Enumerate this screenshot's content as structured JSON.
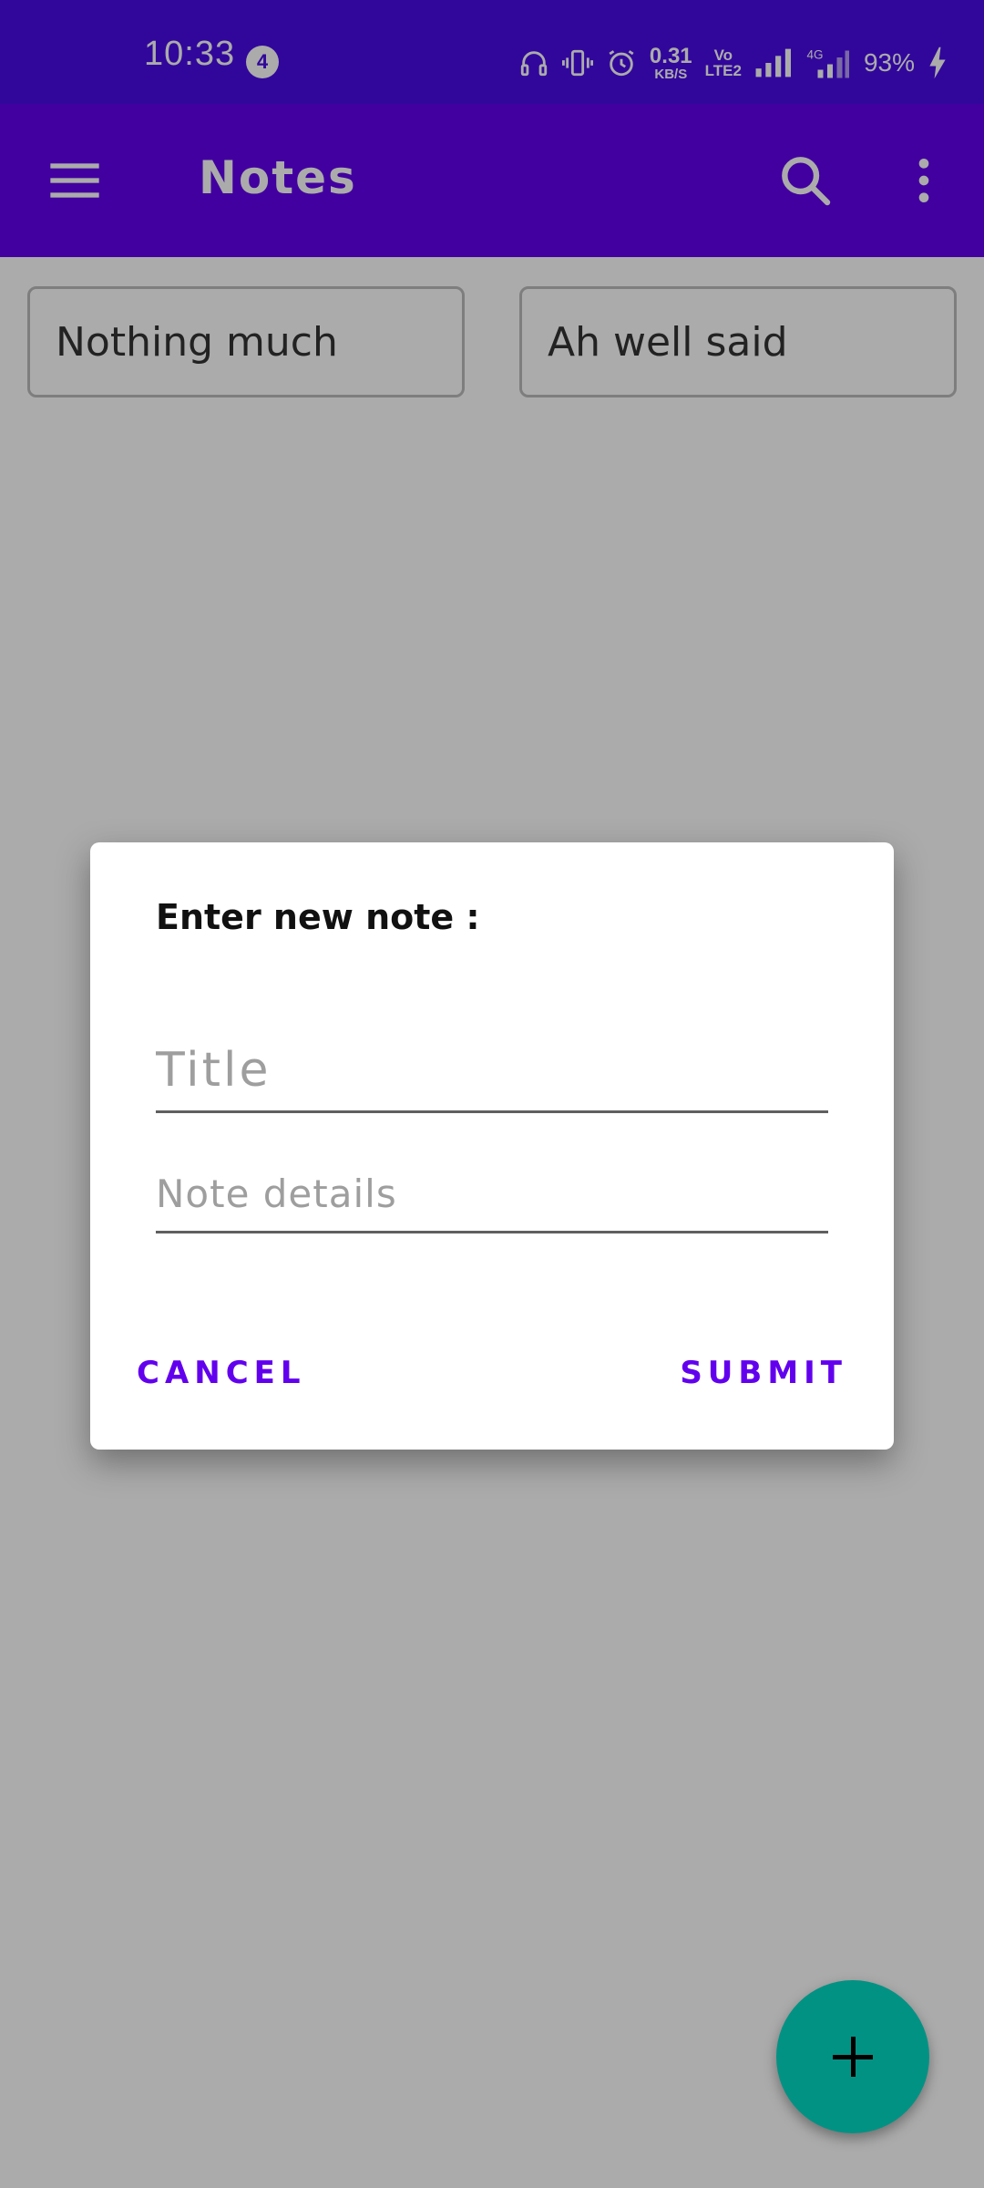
{
  "status_bar": {
    "time": "10:33",
    "notification_count": "4",
    "net_speed_value": "0.31",
    "net_speed_unit": "KB/S",
    "volte_top": "Vo",
    "volte_bottom": "LTE2",
    "battery_percent": "93%",
    "icons": [
      "headphones-icon",
      "vibrate-icon",
      "alarm-icon",
      "signal-icon",
      "signal-4g-icon",
      "battery-charging-icon"
    ]
  },
  "app_bar": {
    "title": "Notes",
    "icons": [
      "menu-icon",
      "search-icon",
      "more-vert-icon"
    ]
  },
  "notes": [
    {
      "title": "Nothing much"
    },
    {
      "title": "Ah well said"
    }
  ],
  "dialog": {
    "title": "Enter new note :",
    "title_placeholder": "Title",
    "details_placeholder": "Note details",
    "cancel_label": "CANCEL",
    "submit_label": "SUBMIT"
  },
  "fab": {
    "icon": "add-icon"
  },
  "colors": {
    "status_bar": "#4a0be8",
    "primary": "#6200ee",
    "accent": "#03dac5",
    "scrim": "rgba(0,0,0,0.33)"
  }
}
